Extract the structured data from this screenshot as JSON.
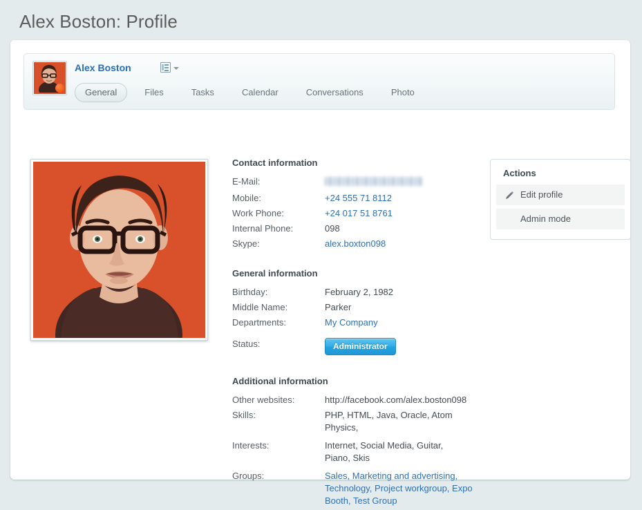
{
  "page": {
    "title": "Alex Boston: Profile"
  },
  "profile_header": {
    "name": "Alex Boston",
    "card_menu_icon": "business-card-icon",
    "caret_icon": "chevron-down-icon",
    "avatar_alt": "alex-boston-avatar",
    "status_indicator": "online-status-dot",
    "tabs": [
      {
        "label": "General",
        "active": true
      },
      {
        "label": "Files",
        "active": false
      },
      {
        "label": "Tasks",
        "active": false
      },
      {
        "label": "Calendar",
        "active": false
      },
      {
        "label": "Conversations",
        "active": false
      },
      {
        "label": "Photo",
        "active": false
      }
    ]
  },
  "photo": {
    "alt": "alex-boston-profile-photo",
    "background_color": "#d8502a"
  },
  "contact_information": {
    "heading": "Contact information",
    "rows": [
      {
        "label": "E-Mail:",
        "value": "",
        "blurred": true,
        "link": false
      },
      {
        "label": "Mobile:",
        "value": "+24 555 71 8112",
        "blurred": false,
        "link": true
      },
      {
        "label": "Work Phone:",
        "value": "+24 017 51 8761",
        "blurred": false,
        "link": true
      },
      {
        "label": "Internal Phone:",
        "value": "098",
        "blurred": false,
        "link": false
      },
      {
        "label": "Skype:",
        "value": "alex.boxton098",
        "blurred": false,
        "link": true
      }
    ]
  },
  "general_information": {
    "heading": "General information",
    "rows": [
      {
        "label": "Birthday:",
        "value": "February 2, 1982",
        "link": false
      },
      {
        "label": "Middle Name:",
        "value": "Parker",
        "link": false
      },
      {
        "label": "Departments:",
        "value": "My Company",
        "link": true
      }
    ],
    "status_label": "Status:",
    "status_badge": "Administrator",
    "status_badge_color": "#28a8e0"
  },
  "additional_information": {
    "heading": "Additional information",
    "rows": [
      {
        "label": "Other websites:",
        "value": "http://facebook.com/alex.boston098",
        "link": false
      },
      {
        "label": "Skills:",
        "value": "PHP, HTML, Java, Oracle, Atom Physics,",
        "link": false
      },
      {
        "label": "Interests:",
        "value": "Internet, Social Media, Guitar, Piano, Skis",
        "link": false
      },
      {
        "label": "Groups:",
        "value": "Sales, Marketing and advertising, Technology, Project workgroup, Expo Booth, Test Group",
        "link": true
      }
    ]
  },
  "actions": {
    "heading": "Actions",
    "items": [
      {
        "label": "Edit profile",
        "icon": "pencil-icon"
      },
      {
        "label": "Admin mode",
        "icon": ""
      }
    ]
  }
}
